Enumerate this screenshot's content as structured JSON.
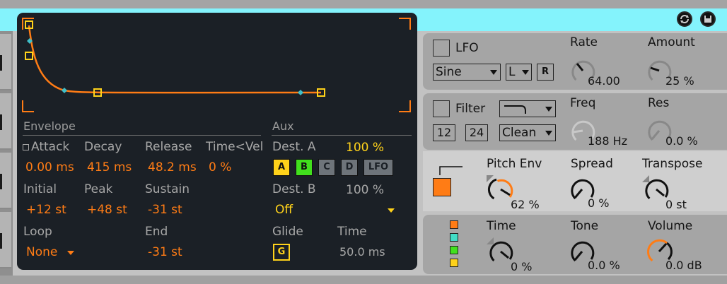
{
  "envelope": {
    "section_title": "Envelope",
    "attack": {
      "label": "Attack",
      "value": "0.00 ms"
    },
    "decay": {
      "label": "Decay",
      "value": "415 ms"
    },
    "release": {
      "label": "Release",
      "value": "48.2 ms"
    },
    "time_vel": {
      "label": "Time<Vel",
      "value": "0 %"
    },
    "initial": {
      "label": "Initial",
      "value": "+12 st"
    },
    "peak": {
      "label": "Peak",
      "value": "+48 st"
    },
    "sustain": {
      "label": "Sustain",
      "value": "-31 st"
    },
    "loop": {
      "label": "Loop",
      "value": "None"
    },
    "end": {
      "label": "End",
      "value": "-31 st"
    }
  },
  "aux": {
    "section_title": "Aux",
    "dest_a": {
      "label": "Dest. A",
      "value": "100 %"
    },
    "dest_buttons": [
      "A",
      "B",
      "C",
      "D",
      "LFO"
    ],
    "dest_b": {
      "label": "Dest. B",
      "value": "100 %",
      "selected": "Off"
    },
    "glide": {
      "label": "Glide",
      "button": "G"
    },
    "time": {
      "label": "Time",
      "value": "50.0 ms"
    }
  },
  "lfo": {
    "label": "LFO",
    "waveform": "Sine",
    "channel": "L",
    "retrigger": "R",
    "rate": {
      "label": "Rate",
      "value": "64.00"
    },
    "amount": {
      "label": "Amount",
      "value": "25 %"
    }
  },
  "filter": {
    "label": "Filter",
    "slope_12": "12",
    "slope_24": "24",
    "mode": "Clean",
    "freq": {
      "label": "Freq",
      "value": "188 Hz"
    },
    "res": {
      "label": "Res",
      "value": "0.0 %"
    }
  },
  "pitch": {
    "pitch_env": {
      "label": "Pitch Env",
      "value": "62 %"
    },
    "spread": {
      "label": "Spread",
      "value": "0 %"
    },
    "transpose": {
      "label": "Transpose",
      "value": "0 st"
    }
  },
  "delay": {
    "time": {
      "label": "Time",
      "value": "0 %"
    },
    "tone": {
      "label": "Tone",
      "value": "0.0 %"
    },
    "volume": {
      "label": "Volume",
      "value": "0.0 dB"
    }
  },
  "colors": {
    "accent_orange": "#ff7c15",
    "accent_yellow": "#ffd21a",
    "accent_green": "#41e01d",
    "accent_cyan": "#84f3fc",
    "display_bg": "#1b2026"
  }
}
